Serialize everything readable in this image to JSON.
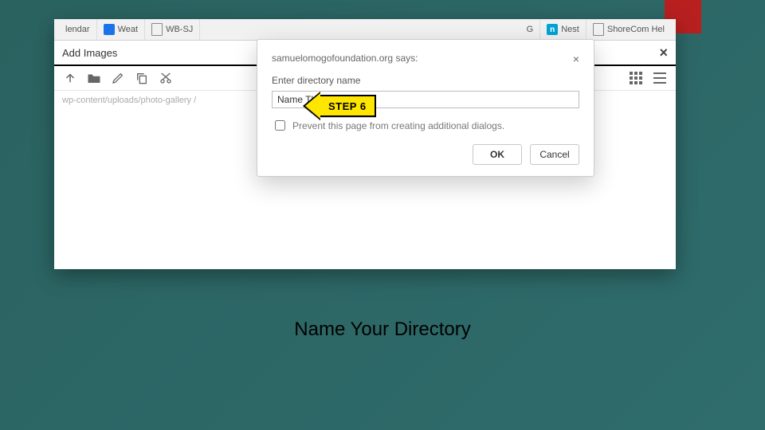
{
  "tabs": {
    "t1": "lendar",
    "t2": "Weat",
    "t3": "WB-SJ",
    "t4_suffix": "G",
    "t5": "Nest",
    "t6": "ShoreCom Hel"
  },
  "panel": {
    "title": "Add Images",
    "breadcrumb": "wp-content/uploads/photo-gallery /"
  },
  "dialog": {
    "origin": "samuelomogofoundation.org says:",
    "label": "Enter directory name",
    "input_value": "Name The Directory",
    "prevent": "Prevent this page from creating additional dialogs.",
    "ok": "OK",
    "cancel": "Cancel"
  },
  "step": {
    "label": "STEP 6"
  },
  "caption": "Name Your Directory",
  "icons": {
    "n": "n"
  }
}
